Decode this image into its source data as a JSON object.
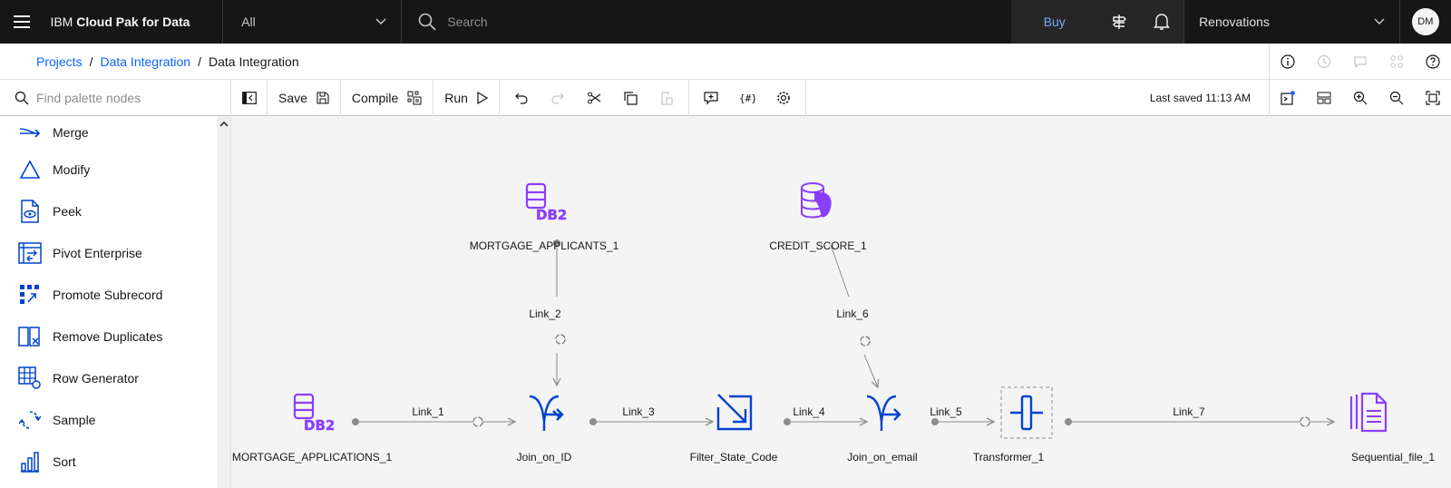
{
  "header": {
    "brand_prefix": "IBM ",
    "brand_bold": "Cloud Pak for Data",
    "scope": "All",
    "search_placeholder": "Search",
    "buy": "Buy",
    "project": "Renovations",
    "avatar": "DM"
  },
  "breadcrumb": {
    "items": [
      "Projects",
      "Data Integration",
      "Data Integration"
    ]
  },
  "toolbar": {
    "palette_search_placeholder": "Find palette nodes",
    "save": "Save",
    "compile": "Compile",
    "run": "Run",
    "last_saved": "Last saved 11:13 AM"
  },
  "palette": {
    "items": [
      {
        "label": "Merge",
        "icon": "merge-icon"
      },
      {
        "label": "Modify",
        "icon": "modify-icon"
      },
      {
        "label": "Peek",
        "icon": "peek-icon"
      },
      {
        "label": "Pivot Enterprise",
        "icon": "pivot-icon"
      },
      {
        "label": "Promote Subrecord",
        "icon": "promote-subrecord-icon"
      },
      {
        "label": "Remove Duplicates",
        "icon": "remove-duplicates-icon"
      },
      {
        "label": "Row Generator",
        "icon": "row-generator-icon"
      },
      {
        "label": "Sample",
        "icon": "sample-icon"
      },
      {
        "label": "Sort",
        "icon": "sort-icon"
      }
    ]
  },
  "canvas": {
    "nodes": {
      "mortgage_applicants": "MORTGAGE_APPLICANTS_1",
      "credit_score": "CREDIT_SCORE_1",
      "mortgage_applications": "MORTGAGE_APPLICATIONS_1",
      "join_id": "Join_on_ID",
      "filter": "Filter_State_Code",
      "join_email": "Join_on_email",
      "transformer": "Transformer_1",
      "seqfile": "Sequential_file_1"
    },
    "links": {
      "link1": "Link_1",
      "link2": "Link_2",
      "link3": "Link_3",
      "link4": "Link_4",
      "link5": "Link_5",
      "link6": "Link_6",
      "link7": "Link_7"
    }
  },
  "colors": {
    "purple": "#8a3ffc",
    "blue": "#0f62fe",
    "node_blue": "#0043ce",
    "link_gray": "#8d8d8d"
  }
}
